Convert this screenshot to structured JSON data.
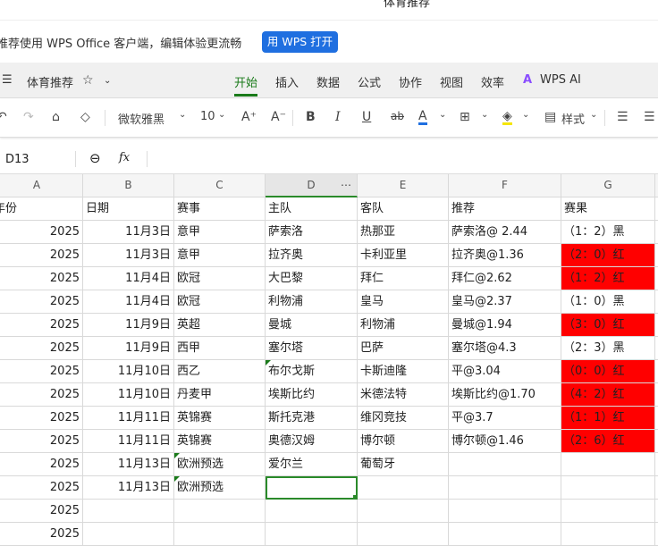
{
  "window": {
    "title": "体育推荐"
  },
  "banner": {
    "text": "推荐使用 WPS Office 客户端，编辑体验更流畅",
    "button": "用 WPS 打开"
  },
  "menu": {
    "doc_name": "体育推荐",
    "tabs": [
      "开始",
      "插入",
      "数据",
      "公式",
      "协作",
      "视图",
      "效率",
      "WPS AI"
    ],
    "active": "开始"
  },
  "toolbar": {
    "font": "微软雅黑",
    "size": "10",
    "style_label": "样式",
    "bold": "B",
    "italic": "I",
    "underline": "U",
    "strike": "ab",
    "font_color": "#1f6fe0",
    "fill_color": "#f5e600"
  },
  "formula": {
    "cell_ref": "D13",
    "fx": "fx",
    "value": ""
  },
  "colors": {
    "accent": "#1a7a1a",
    "hit": "#ff0000"
  },
  "columns": [
    "A",
    "B",
    "C",
    "D",
    "E",
    "F",
    "G"
  ],
  "header_row": [
    "年份",
    "日期",
    "赛事",
    "主队",
    "客队",
    "推荐",
    "赛果"
  ],
  "rows": [
    [
      "2025",
      "11月3日",
      "意甲",
      "萨索洛",
      "热那亚",
      "萨索洛@ 2.44",
      "（1：2）黑"
    ],
    [
      "2025",
      "11月3日",
      "意甲",
      "拉齐奥",
      "卡利亚里",
      "拉齐奥@1.36",
      "（2：0）红"
    ],
    [
      "2025",
      "11月4日",
      "欧冠",
      "大巴黎",
      "拜仁",
      "拜仁@2.62",
      "（1：2）红"
    ],
    [
      "2025",
      "11月4日",
      "欧冠",
      "利物浦",
      "皇马",
      "皇马@2.37",
      "（1：0）黑"
    ],
    [
      "2025",
      "11月9日",
      "英超",
      "曼城",
      "利物浦",
      "曼城@1.94",
      "（3：0）红"
    ],
    [
      "2025",
      "11月9日",
      "西甲",
      "塞尔塔",
      "巴萨",
      "塞尔塔@4.3",
      "（2：3）黑"
    ],
    [
      "2025",
      "11月10日",
      "西乙",
      "布尔戈斯",
      "卡斯迪隆",
      "平@3.04",
      "（0：0）红"
    ],
    [
      "2025",
      "11月10日",
      "丹麦甲",
      "埃斯比约",
      "米德法特",
      "埃斯比约@1.70",
      "（4：2）红"
    ],
    [
      "2025",
      "11月11日",
      "英锦赛",
      "斯托克港",
      "维冈竞技",
      "平@3.7",
      "（1：1）红"
    ],
    [
      "2025",
      "11月11日",
      "英锦赛",
      "奥德汉姆",
      "博尔顿",
      "博尔顿@1.46",
      "（2：6）红"
    ],
    [
      "2025",
      "11月13日",
      "欧洲预选",
      "爱尔兰",
      "葡萄牙",
      "",
      ""
    ],
    [
      "2025",
      "11月13日",
      "欧洲预选",
      "",
      "",
      "",
      ""
    ],
    [
      "2025",
      "",
      "",
      "",
      "",
      "",
      ""
    ],
    [
      "2025",
      "",
      "",
      "",
      "",
      "",
      ""
    ]
  ]
}
